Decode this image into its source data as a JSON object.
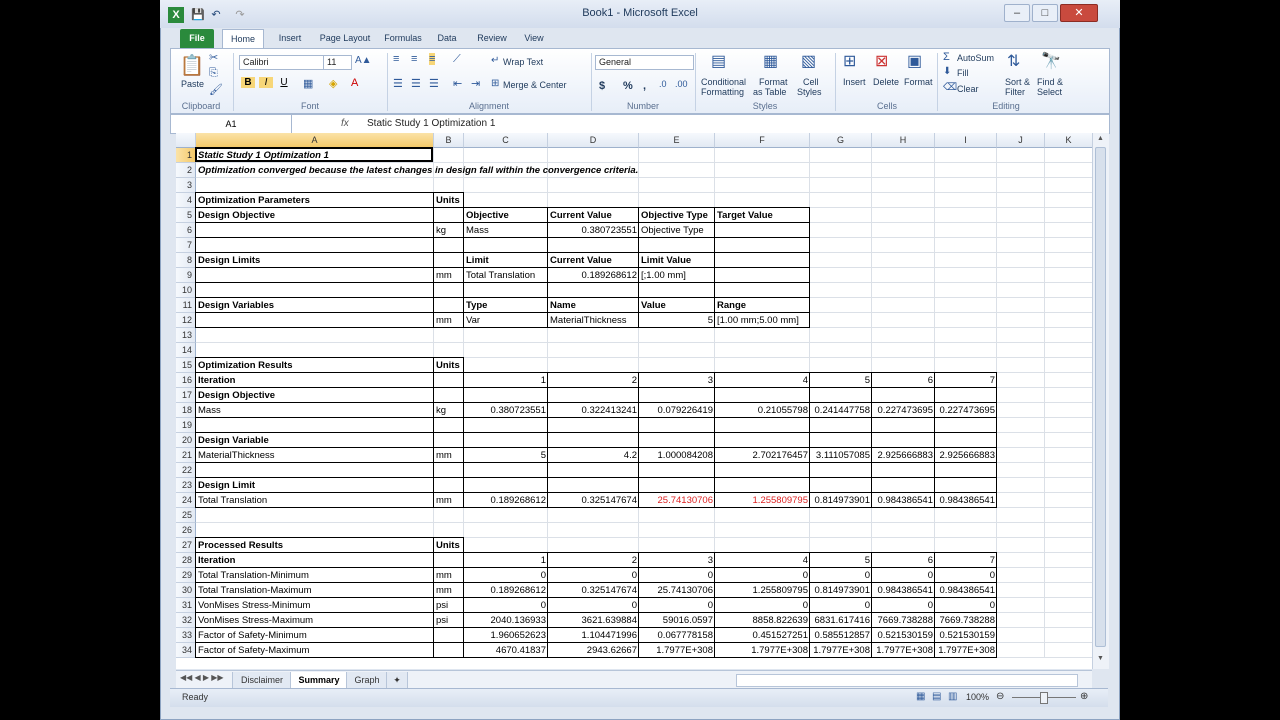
{
  "window": {
    "title": "Book1 - Microsoft Excel",
    "quick_access": [
      "save-icon",
      "undo-icon",
      "redo-icon"
    ],
    "controls": {
      "minimize": "–",
      "maximize": "□",
      "close": "✕"
    }
  },
  "ribbon_tabs": [
    "File",
    "Home",
    "Insert",
    "Page Layout",
    "Formulas",
    "Data",
    "Review",
    "View"
  ],
  "ribbon": {
    "clipboard": {
      "label": "Clipboard",
      "paste": "Paste"
    },
    "font": {
      "label": "Font",
      "family": "Calibri",
      "size": "11",
      "bold": "B",
      "italic": "I",
      "underline": "U"
    },
    "alignment": {
      "label": "Alignment",
      "wrap_text": "Wrap Text",
      "merge_center": "Merge & Center"
    },
    "number": {
      "label": "Number",
      "format": "General",
      "currency": "$",
      "percent": "%",
      "comma": ","
    },
    "styles": {
      "label": "Styles",
      "conditional": "Conditional",
      "conditional2": "Formatting",
      "format_table": "Format",
      "format_table2": "as Table",
      "cell_styles": "Cell",
      "cell_styles2": "Styles"
    },
    "cells": {
      "label": "Cells",
      "insert": "Insert",
      "delete": "Delete",
      "format": "Format"
    },
    "editing": {
      "label": "Editing",
      "autosum": "AutoSum",
      "fill": "Fill",
      "clear": "Clear",
      "sort": "Sort &",
      "sort2": "Filter",
      "find": "Find &",
      "find2": "Select"
    }
  },
  "formula_bar": {
    "name_box": "A1",
    "fx": "fx",
    "value": "Static Study 1 Optimization 1"
  },
  "columns": [
    "A",
    "B",
    "C",
    "D",
    "E",
    "F",
    "G",
    "H",
    "I",
    "J",
    "K"
  ],
  "rows": [
    "1",
    "2",
    "3",
    "4",
    "5",
    "6",
    "7",
    "8",
    "9",
    "10",
    "11",
    "12",
    "13",
    "14",
    "15",
    "16",
    "17",
    "18",
    "19",
    "20",
    "21",
    "22",
    "23",
    "24",
    "25",
    "26",
    "27",
    "28",
    "29",
    "30",
    "31",
    "32",
    "33",
    "34"
  ],
  "cells": {
    "A1": "Static Study 1 Optimization 1",
    "A2": "Optimization converged because the latest changes in design fall within the convergence criteria.",
    "A4": "Optimization Parameters",
    "B4": "Units",
    "A5": "Design Objective",
    "C5": "Objective",
    "D5": "Current Value",
    "E5": "Objective Type",
    "F5": "Target Value",
    "B6": "kg",
    "C6": "Mass",
    "D6": "0.380723551",
    "E6": "Objective Type",
    "A8": "Design Limits",
    "C8": "Limit",
    "D8": "Current Value",
    "E8": "Limit Value",
    "B9": "mm",
    "C9": "Total Translation",
    "D9": "0.189268612",
    "E9": "[;1.00 mm]",
    "A11": "Design Variables",
    "C11": "Type",
    "D11": "Name",
    "E11": "Value",
    "F11": "Range",
    "B12": "mm",
    "C12": "Var",
    "D12": "MaterialThickness",
    "E12": "5",
    "F12": "[1.00 mm;5.00 mm]",
    "A15": "Optimization Results",
    "B15": "Units",
    "A16": "Iteration",
    "C16": "1",
    "D16": "2",
    "E16": "3",
    "F16": "4",
    "G16": "5",
    "H16": "6",
    "I16": "7",
    "A17": "Design Objective",
    "A18": "Mass",
    "B18": "kg",
    "C18": "0.380723551",
    "D18": "0.322413241",
    "E18": "0.079226419",
    "F18": "0.21055798",
    "G18": "0.241447758",
    "H18": "0.227473695",
    "I18": "0.227473695",
    "A20": "Design Variable",
    "A21": "MaterialThickness",
    "B21": "mm",
    "C21": "5",
    "D21": "4.2",
    "E21": "1.000084208",
    "F21": "2.702176457",
    "G21": "3.111057085",
    "H21": "2.925666883",
    "I21": "2.925666883",
    "A23": "Design Limit",
    "A24": "Total Translation",
    "B24": "mm",
    "C24": "0.189268612",
    "D24": "0.325147674",
    "E24": "25.74130706",
    "F24": "1.255809795",
    "G24": "0.814973901",
    "H24": "0.984386541",
    "I24": "0.984386541",
    "A27": "Processed Results",
    "B27": "Units",
    "A28": "Iteration",
    "C28": "1",
    "D28": "2",
    "E28": "3",
    "F28": "4",
    "G28": "5",
    "H28": "6",
    "I28": "7",
    "A29": "Total Translation-Minimum",
    "B29": "mm",
    "C29": "0",
    "D29": "0",
    "E29": "0",
    "F29": "0",
    "G29": "0",
    "H29": "0",
    "I29": "0",
    "A30": "Total Translation-Maximum",
    "B30": "mm",
    "C30": "0.189268612",
    "D30": "0.325147674",
    "E30": "25.74130706",
    "F30": "1.255809795",
    "G30": "0.814973901",
    "H30": "0.984386541",
    "I30": "0.984386541",
    "A31": "VonMises Stress-Minimum",
    "B31": "psi",
    "C31": "0",
    "D31": "0",
    "E31": "0",
    "F31": "0",
    "G31": "0",
    "H31": "0",
    "I31": "0",
    "A32": "VonMises Stress-Maximum",
    "B32": "psi",
    "C32": "2040.136933",
    "D32": "3621.639884",
    "E32": "59016.0597",
    "F32": "8858.822639",
    "G32": "6831.617416",
    "H32": "7669.738288",
    "I32": "7669.738288",
    "A33": "Factor of Safety-Minimum",
    "C33": "1.960652623",
    "D33": "1.104471996",
    "E33": "0.067778158",
    "F33": "0.451527251",
    "G33": "0.585512857",
    "H33": "0.521530159",
    "I33": "0.521530159",
    "A34": "Factor of Safety-Maximum",
    "C34": "4670.41837",
    "D34": "2943.62667",
    "E34": "1.7977E+308",
    "F34": "1.7977E+308",
    "G34": "1.7977E+308",
    "H34": "1.7977E+308",
    "I34": "1.7977E+308"
  },
  "red_cells": [
    "E24",
    "F24"
  ],
  "sheet_tabs": [
    "Disclaimer",
    "Summary",
    "Graph"
  ],
  "active_sheet": "Summary",
  "status": {
    "ready": "Ready",
    "zoom": "100%"
  }
}
